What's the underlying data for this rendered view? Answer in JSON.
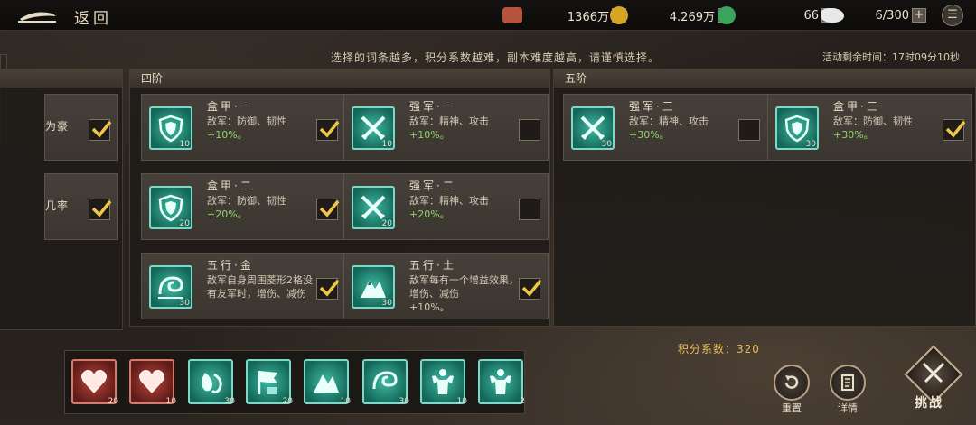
{
  "header": {
    "back_label": "返回",
    "resources": [
      {
        "name": "copper-ingot",
        "value": "1366万",
        "color": "#b5533f"
      },
      {
        "name": "gold-coin",
        "value": "4.269万",
        "color": "#d5a523"
      },
      {
        "name": "jade-disc",
        "value": "66",
        "color": "#3aa35c"
      },
      {
        "name": "silver",
        "value": "6/300",
        "color": "#e8e8e8"
      }
    ],
    "plus": "+",
    "menu": "☰"
  },
  "notice": "选择的词条越多，积分系数越难，副本难度越高，请谨慎选择。",
  "timer": "活动剩余时间：17时09分10秒",
  "partial": {
    "cards": [
      {
        "name": "为豪",
        "checked": true
      },
      {
        "name": "几率",
        "checked": true
      }
    ]
  },
  "tier4": {
    "title": "四阶",
    "cards": [
      {
        "name": "盒甲·一",
        "desc": "敌军：防御、韧性",
        "bonus": "+10%。",
        "level": "10",
        "icon": "shield",
        "checked": true
      },
      {
        "name": "强军·一",
        "desc": "敌军：精神、攻击",
        "bonus": "+10%。",
        "level": "10",
        "icon": "swords",
        "checked": false
      },
      {
        "name": "盒甲·二",
        "desc": "敌军：防御、韧性",
        "bonus": "+20%。",
        "level": "20",
        "icon": "shield",
        "checked": true
      },
      {
        "name": "强军·二",
        "desc": "敌军：精神、攻击",
        "bonus": "+20%。",
        "level": "20",
        "icon": "swords",
        "checked": false
      },
      {
        "name": "五行·金",
        "desc": "敌军自身周围菱形2格没有友军时，增伤、减伤",
        "bonus": "",
        "level": "30",
        "icon": "wave",
        "checked": true
      },
      {
        "name": "五行·土",
        "desc": "敌军每有一个增益效果，增伤、减伤",
        "bonus": "+10%。",
        "level": "30",
        "icon": "mountain",
        "checked": true
      }
    ]
  },
  "tier5": {
    "title": "五阶",
    "cards": [
      {
        "name": "强军·三",
        "desc": "敌军：精神、攻击",
        "bonus": "+30%。",
        "level": "30",
        "icon": "swords",
        "checked": false
      },
      {
        "name": "盒甲·三",
        "desc": "敌军：防御、韧性",
        "bonus": "+30%。",
        "level": "30",
        "icon": "shield",
        "checked": true
      }
    ]
  },
  "score": "积分系数：320",
  "selected": [
    {
      "icon": "heart",
      "level": "20",
      "red": true
    },
    {
      "icon": "heart",
      "level": "10",
      "red": true
    },
    {
      "icon": "wave",
      "level": "30",
      "red": false
    },
    {
      "icon": "flag",
      "level": "20",
      "red": false
    },
    {
      "icon": "mountain",
      "level": "10",
      "red": false
    },
    {
      "icon": "wave",
      "level": "30",
      "red": false
    },
    {
      "icon": "muscle",
      "level": "10",
      "red": false
    },
    {
      "icon": "muscle",
      "level": "2",
      "red": false
    }
  ],
  "actions": {
    "reset": "重置",
    "details": "详情",
    "fight": "挑战"
  }
}
